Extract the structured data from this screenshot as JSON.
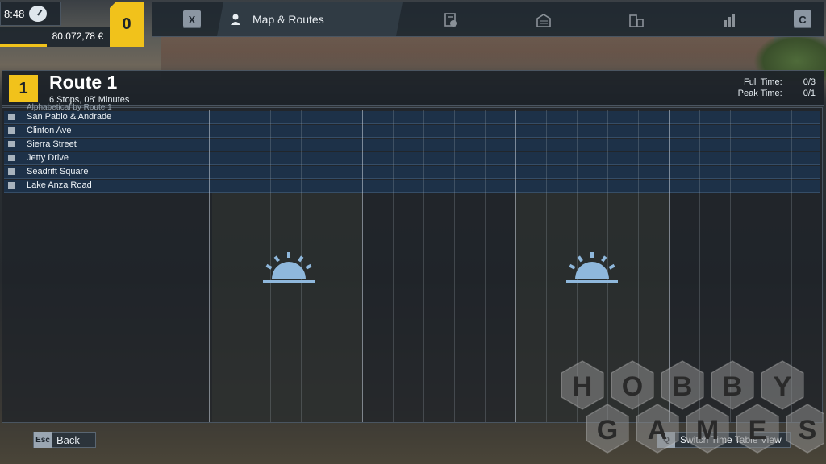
{
  "status": {
    "time": "8:48",
    "money": "80.072,78 €",
    "level": "0"
  },
  "nav": {
    "left_key": "X",
    "right_key": "C",
    "active_tab": "Map & Routes",
    "other_tabs": [
      "timetable-icon",
      "depot-icon",
      "buildings-icon",
      "statistics-icon"
    ]
  },
  "route": {
    "number": "1",
    "title": "Route 1",
    "subtitle": "6 Stops, 08' Minutes",
    "full_time_label": "Full Time:",
    "full_time_value": "0/3",
    "peak_time_label": "Peak Time:",
    "peak_time_value": "0/1",
    "partial_header": "Alphabetical by Route 1"
  },
  "stops": [
    "San Pablo & Andrade",
    "Clinton Ave",
    "Sierra Street",
    "Jetty Drive",
    "Seadrift Square",
    "Lake Anza Road"
  ],
  "footer": {
    "back_key": "Esc",
    "back_label": "Back",
    "switch_key": "Q",
    "switch_label": "Switch Time Table View"
  },
  "watermark": {
    "line1": [
      "H",
      "O",
      "B",
      "B",
      "Y"
    ],
    "line2": [
      "G",
      "A",
      "M",
      "E",
      "S"
    ]
  },
  "colors": {
    "accent": "#f1c21b",
    "row_blue": "#1c344e",
    "sun": "#8fb8dc"
  }
}
